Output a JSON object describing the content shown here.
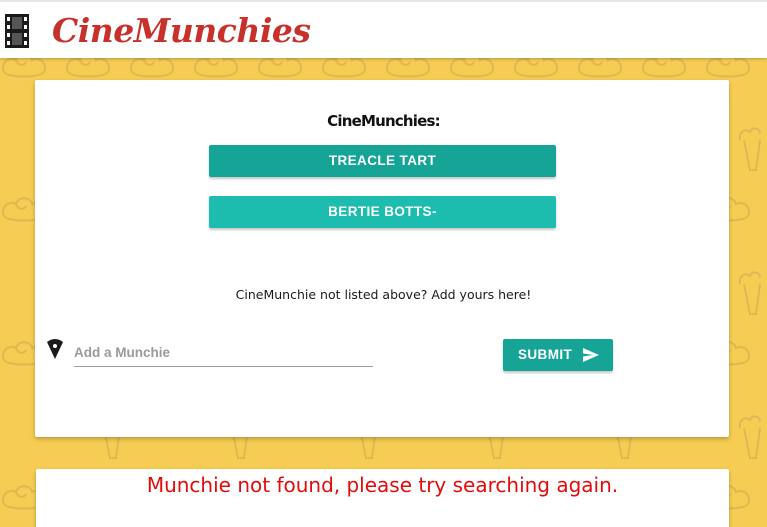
{
  "header": {
    "brand": "CineMunchies",
    "logo_icon": "film-strip-icon"
  },
  "munchie_list": {
    "title": "CineMunchies:",
    "items": [
      {
        "label": "TREACLE TART",
        "color": "#16a497"
      },
      {
        "label": "BERTIE BOTTS-",
        "color": "#1cbdaf"
      }
    ]
  },
  "add_form": {
    "prompt": "CineMunchie not listed above? Add yours here!",
    "input_icon": "pizza-slice-icon",
    "input_placeholder": "Add a Munchie",
    "input_value": "",
    "submit_label": "SUBMIT",
    "submit_icon": "send-icon"
  },
  "results": {
    "error_message": "Munchie not found, please try searching again."
  },
  "colors": {
    "background": "#f6cd52",
    "brand": "#c8312b",
    "button": "#16a497",
    "error": "#e30b0b"
  }
}
